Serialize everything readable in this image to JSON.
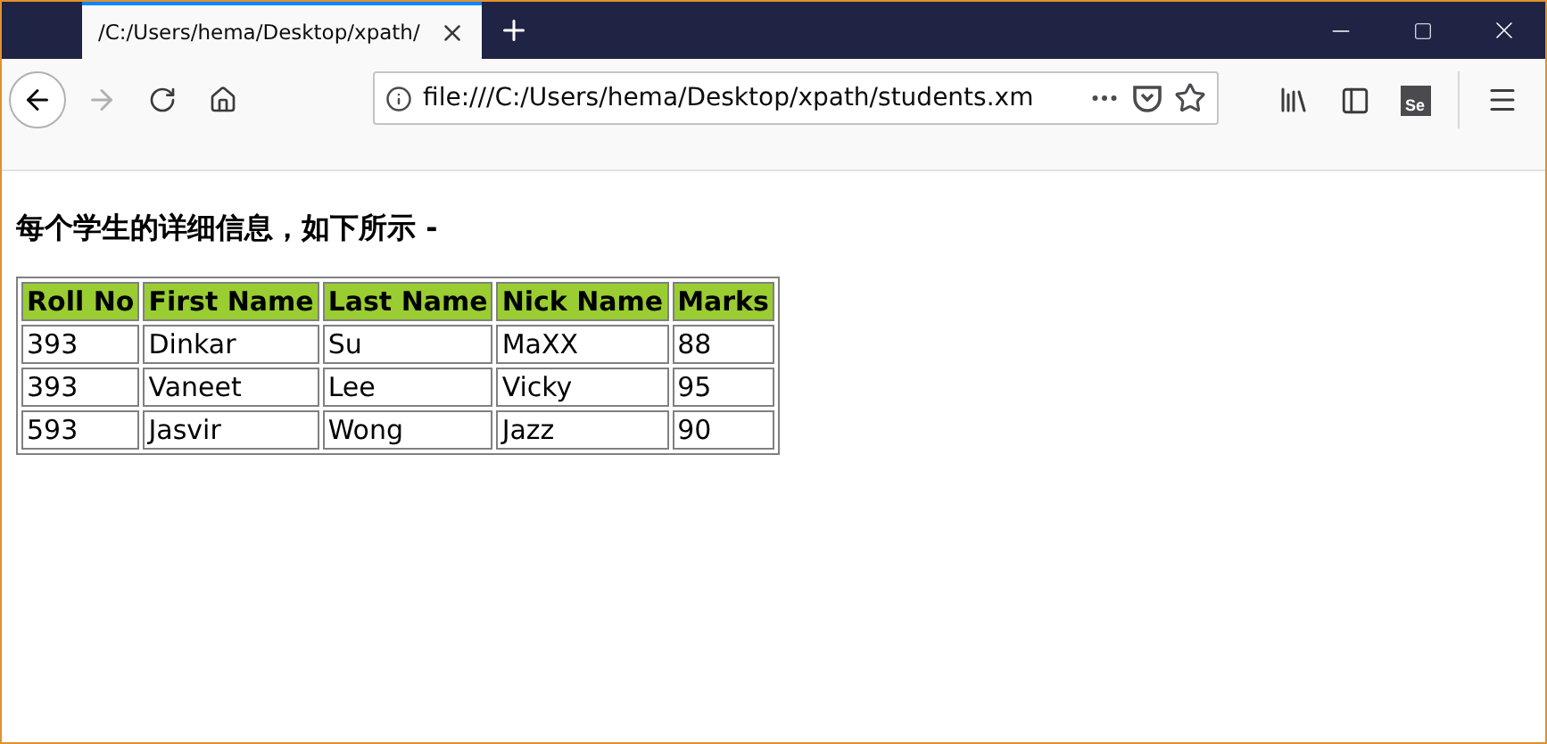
{
  "tab": {
    "title": "/C:/Users/hema/Desktop/xpath/",
    "selected": true
  },
  "address_bar": {
    "url": "file:///C:/Users/hema/Desktop/xpath/students.xm"
  },
  "extension_label": "Se",
  "heading": "每个学生的详细信息，如下所示 -",
  "table": {
    "columns": [
      "Roll No",
      "First Name",
      "Last Name",
      "Nick Name",
      "Marks"
    ],
    "rows": [
      [
        "393",
        "Dinkar",
        "Su",
        "MaXX",
        "88"
      ],
      [
        "393",
        "Vaneet",
        "Lee",
        "Vicky",
        "95"
      ],
      [
        "593",
        "Jasvir",
        "Wong",
        "Jazz",
        "90"
      ]
    ]
  }
}
